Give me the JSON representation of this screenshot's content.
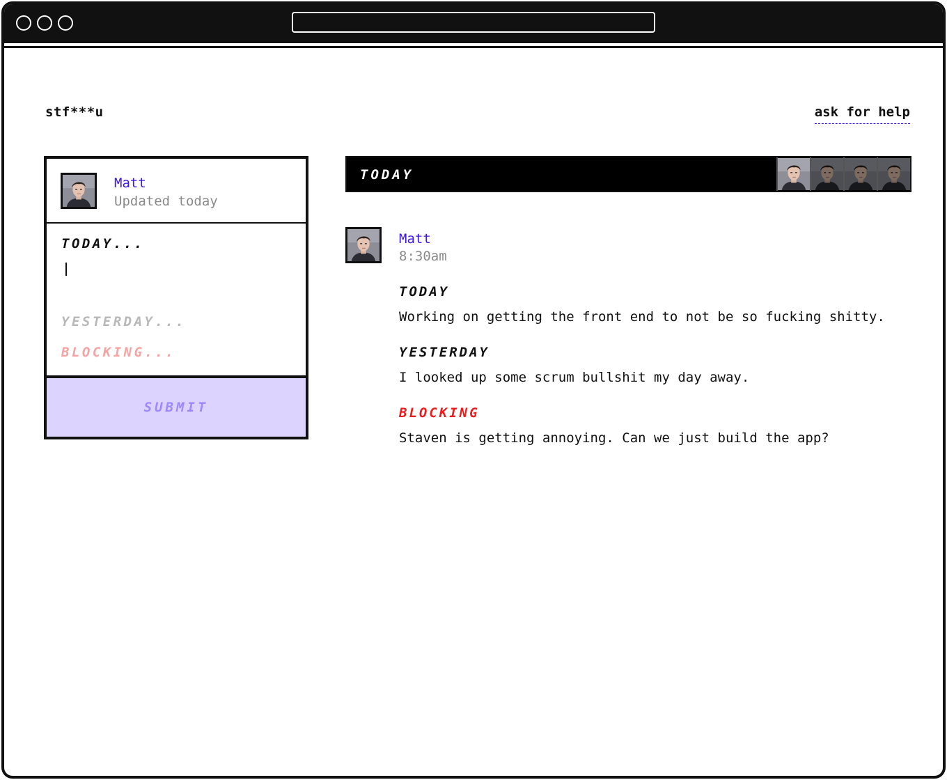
{
  "app": {
    "brand": "stf***u",
    "help_link": "ask for help"
  },
  "form": {
    "user_name": "Matt",
    "user_status": "Updated today",
    "today_label": "TODAY...",
    "yesterday_label": "YESTERDAY...",
    "blocking_label": "BLOCKING...",
    "submit_label": "SUBMIT"
  },
  "feed": {
    "day_title": "TODAY",
    "posts": [
      {
        "author": "Matt",
        "time": "8:30am",
        "sections": [
          {
            "title": "TODAY",
            "body": "Working on getting the front end to not be so fucking shitty."
          },
          {
            "title": "YESTERDAY",
            "body": "I looked up some scrum bullshit my day away."
          },
          {
            "title": "BLOCKING",
            "body": "Staven is getting annoying. Can we just build the app?"
          }
        ]
      }
    ]
  },
  "colors": {
    "accent": "#3d17e6",
    "blocking": "#ee1c1c",
    "submit_bg": "#dcd3ff",
    "submit_text": "#9d88ff",
    "muted": "#8a8a8a"
  },
  "icons": {
    "avatar": "person-portrait-icon"
  }
}
